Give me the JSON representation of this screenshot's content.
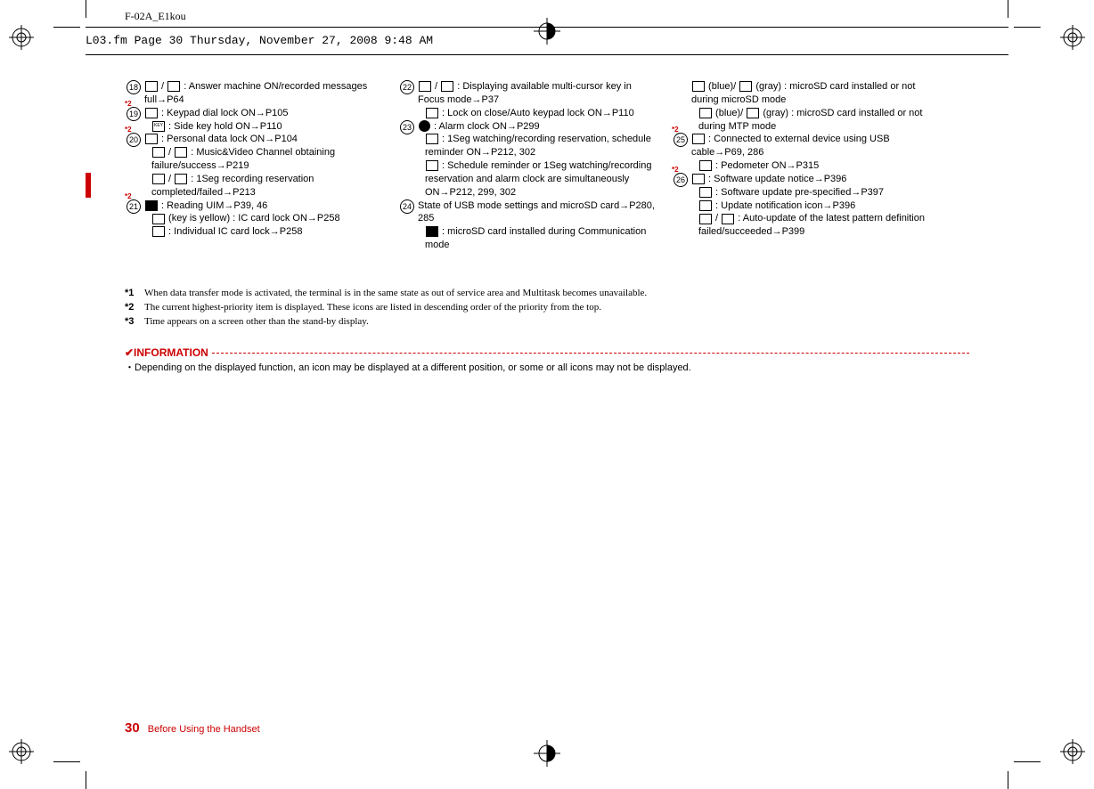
{
  "header_filename": "F-02A_E1kou",
  "frame_meta": "L03.fm  Page 30  Thursday, November 27, 2008  9:48 AM",
  "col1": [
    {
      "sup": "",
      "num": "18",
      "lines": [
        "◻ / ◻ : Answer machine ON/recorded messages full→P64"
      ]
    },
    {
      "sup": "*2",
      "num": "19",
      "lines": [
        "◻ : Keypad dial lock ON→P105",
        "KEY : Side key hold ON→P110"
      ]
    },
    {
      "sup": "*2",
      "num": "20",
      "lines": [
        "◻ : Personal data lock ON→P104",
        "◻ / ◻ : Music&Video Channel obtaining failure/success→P219",
        "◻ / ◻ : 1Seg recording reservation completed/failed→P213"
      ]
    },
    {
      "sup": "*2",
      "num": "21",
      "lines": [
        "■ : Reading UIM→P39, 46",
        "◻ (key is yellow) : IC card lock ON→P258",
        "◻ : Individual IC card lock→P258"
      ]
    }
  ],
  "col2": [
    {
      "sup": "",
      "num": "22",
      "lines": [
        "◻ / ◻ : Displaying available multi-cursor key in Focus mode→P37",
        "◻ : Lock on close/Auto keypad lock ON→P110"
      ]
    },
    {
      "sup": "",
      "num": "23",
      "lines": [
        "● : Alarm clock ON→P299",
        "◻ : 1Seg watching/recording reservation, schedule reminder ON→P212, 302",
        "◻ : Schedule reminder or 1Seg watching/recording reservation and alarm clock are simultaneously ON→P212, 299, 302"
      ]
    },
    {
      "sup": "",
      "num": "24",
      "lines_prefix": "State of USB mode settings and microSD card→P280, 285",
      "lines": [
        "■ : microSD card installed during Communication mode"
      ]
    }
  ],
  "col3": [
    {
      "lines": [
        "◻ (blue)/ ◻ (gray) : microSD card installed or not during microSD mode",
        "◻ (blue)/ ◻ (gray) : microSD card installed or not during MTP mode"
      ]
    },
    {
      "sup": "*2",
      "num": "25",
      "lines": [
        "◻ : Connected to external device using USB cable→P69, 286",
        "◻ : Pedometer ON→P315"
      ]
    },
    {
      "sup": "*2",
      "num": "26",
      "lines": [
        "◻ : Software update notice→P396",
        "◻ : Software update pre-specified→P397",
        "◻ : Update notification icon→P396",
        "◻ / ◻ : Auto-update of the latest pattern definition failed/succeeded→P399"
      ]
    }
  ],
  "footnotes": [
    {
      "label": "*1",
      "text": "When data transfer mode is activated, the terminal is in the same state as out of service area and Multitask becomes unavailable."
    },
    {
      "label": "*2",
      "text": "The current highest-priority item is displayed. These icons are listed in descending order of the priority from the top."
    },
    {
      "label": "*3",
      "text": "Time appears on a screen other than the stand-by display."
    }
  ],
  "info_header": "✔INFORMATION",
  "info_bullet_prefix": "・",
  "info_body": "Depending on the displayed function, an icon may be displayed at a different position, or some or all icons may not be displayed.",
  "page_number": "30",
  "section_title": "Before Using the Handset"
}
